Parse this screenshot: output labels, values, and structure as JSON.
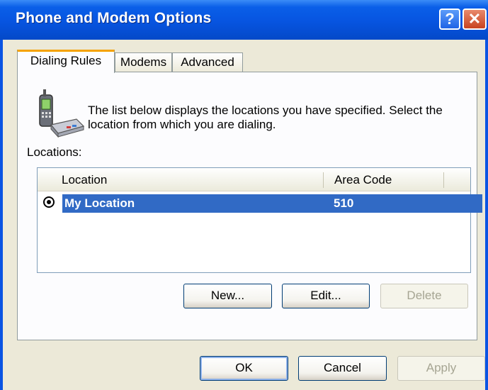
{
  "window": {
    "title": "Phone and Modem Options",
    "help_glyph": "?",
    "close_glyph": "✕"
  },
  "tabs": [
    {
      "label": "Dialing Rules",
      "active": true
    },
    {
      "label": "Modems",
      "active": false
    },
    {
      "label": "Advanced",
      "active": false
    }
  ],
  "panel": {
    "icon": "phone-modem-icon",
    "description": "The list below displays the locations you have specified. Select the location from which you are dialing.",
    "locations_label": "Locations:",
    "columns": [
      "Location",
      "Area Code"
    ],
    "rows": [
      {
        "location": "My Location",
        "area_code": "510",
        "selected": true
      }
    ],
    "buttons": {
      "new": "New...",
      "edit": "Edit...",
      "delete": "Delete"
    }
  },
  "footer": {
    "ok": "OK",
    "cancel": "Cancel",
    "apply": "Apply"
  },
  "colors": {
    "title_bar": "#0a54e3",
    "selection": "#316ac5",
    "face": "#ece9d8",
    "active_tab_accent": "#f5a200"
  }
}
